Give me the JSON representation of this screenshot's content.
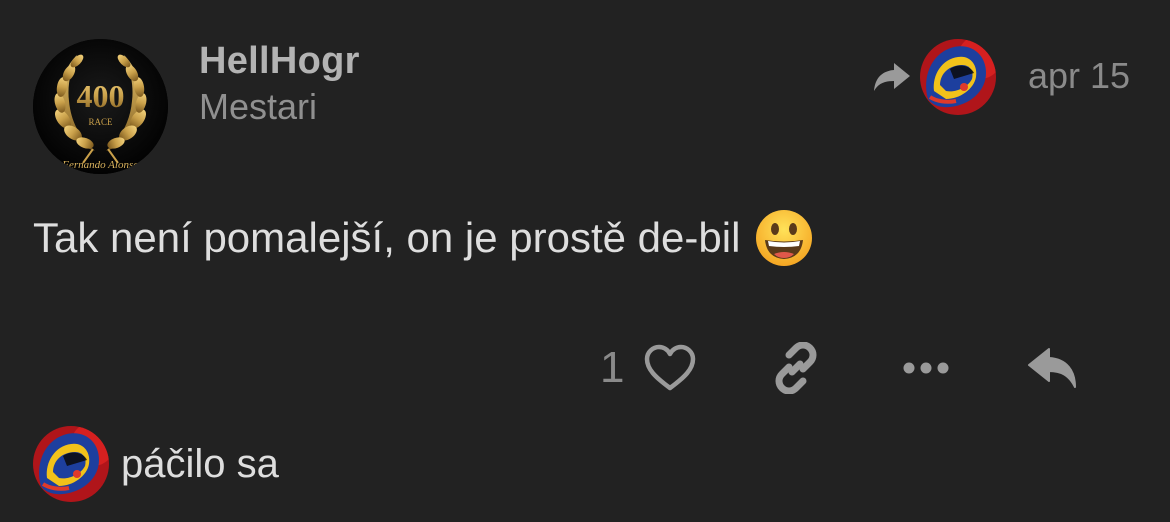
{
  "post": {
    "author": {
      "username": "HellHogr",
      "title": "Mestari",
      "avatar_badge": {
        "number": "400",
        "caption": "RACE",
        "signature": "Fernando Alonso"
      }
    },
    "reply_to": {
      "icon": "share-arrow-icon",
      "avatar": "helmet-avatar"
    },
    "date": "apr 15",
    "body": "Tak není pomalejší, on je prostě de-bil",
    "emoji": "grinning-face-emoji",
    "actions": {
      "like_count": "1",
      "icons": [
        "heart-icon",
        "link-icon",
        "more-icon",
        "reply-icon"
      ]
    },
    "liked_by": {
      "label": "páčilo sa",
      "avatar": "helmet-avatar"
    }
  },
  "colors": {
    "background": "#222222",
    "muted_text": "#8a8a8a",
    "body_text": "#dedede",
    "gold": "#c9a04a"
  }
}
